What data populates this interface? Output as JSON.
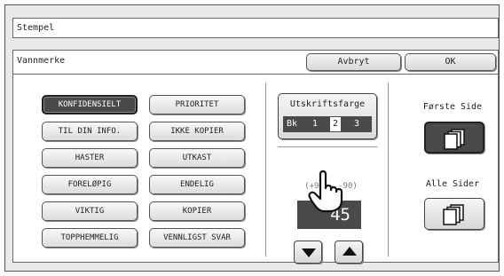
{
  "window": {
    "title": "Stempel"
  },
  "panel": {
    "title": "Vannmerke",
    "cancel_label": "Avbryt",
    "ok_label": "OK"
  },
  "stamps": {
    "left": [
      "KONFIDENSIELT",
      "TIL DIN INFO.",
      "HASTER",
      "FORELØPIG",
      "VIKTIG",
      "TOPPHEMMELIG"
    ],
    "right": [
      "PRIORITET",
      "IKKE KOPIER",
      "UTKAST",
      "ENDELIG",
      "KOPIER",
      "VENNLIGST SVAR"
    ],
    "selected": "KONFIDENSIELT"
  },
  "print_color": {
    "label": "Utskriftsfarge",
    "options": [
      "Bk",
      "1",
      "2",
      "3"
    ],
    "selected": "2"
  },
  "angle": {
    "range_label": "(+90 ~ -90)",
    "value": "45"
  },
  "pages": {
    "first_label": "Første Side",
    "all_label": "Alle Sider",
    "selected": "Første Side"
  },
  "icons": {
    "first_page": "stacked-pages-icon",
    "all_pages": "stacked-pages-icon",
    "pointer": "pointing-hand-icon",
    "angle_down": "triangle-down-icon",
    "angle_up": "triangle-up-icon"
  }
}
